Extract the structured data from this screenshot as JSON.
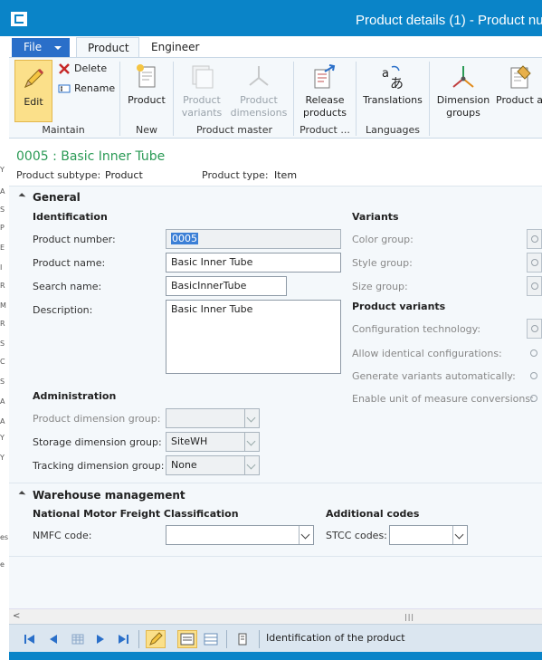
{
  "window": {
    "title": "Product details (1) - Product nu"
  },
  "left_strip": {
    "chars": [
      "Y",
      "A",
      "S",
      "P",
      "E",
      "I",
      "R",
      "M",
      "R",
      "S",
      "C",
      "S",
      "A",
      "A",
      "Y",
      "Y",
      "es",
      "e"
    ]
  },
  "tabs": {
    "file": "File",
    "product": "Product",
    "engineer": "Engineer"
  },
  "ribbon": {
    "maintain": {
      "edit": "Edit",
      "delete": "Delete",
      "rename": "Rename",
      "label": "Maintain"
    },
    "new": {
      "product": "Product",
      "label": "New"
    },
    "product_master": {
      "variants": "Product variants",
      "dimensions": "Product dimensions",
      "label": "Product master"
    },
    "product_group": {
      "release": "Release products",
      "label": "Product ..."
    },
    "languages": {
      "translations": "Translations",
      "label": "Languages"
    },
    "dimension_groups": "Dimension groups",
    "attributes": "Product attributes"
  },
  "header": {
    "product_heading": "0005 : Basic Inner Tube",
    "subtype_label": "Product subtype:",
    "subtype_value": "Product",
    "type_label": "Product type:",
    "type_value": "Item"
  },
  "general": {
    "title": "General",
    "identification": {
      "title": "Identification",
      "product_number_label": "Product number:",
      "product_number": "0005",
      "product_name_label": "Product name:",
      "product_name": "Basic Inner Tube",
      "search_name_label": "Search name:",
      "search_name": "BasicInnerTube",
      "description_label": "Description:",
      "description": "Basic Inner Tube"
    },
    "administration": {
      "title": "Administration",
      "product_dim_label": "Product dimension group:",
      "product_dim": "",
      "storage_dim_label": "Storage dimension group:",
      "storage_dim": "SiteWH",
      "tracking_dim_label": "Tracking dimension group:",
      "tracking_dim": "None"
    },
    "variants": {
      "title": "Variants",
      "color_label": "Color group:",
      "style_label": "Style group:",
      "size_label": "Size group:"
    },
    "product_variants": {
      "title": "Product variants",
      "config_label": "Configuration technology:",
      "allow_label": "Allow identical configurations:",
      "generate_label": "Generate variants automatically:",
      "enable_label": "Enable unit of measure conversions:"
    }
  },
  "warehouse": {
    "title": "Warehouse management",
    "nmfc_title": "National Motor Freight Classification",
    "nmfc_label": "NMFC code:",
    "nmfc_value": "",
    "additional_title": "Additional codes",
    "stcc_label": "STCC codes:",
    "stcc_value": ""
  },
  "status": {
    "text": "Identification of the product"
  },
  "colors": {
    "titlebar": "#0a84c8",
    "accent": "#2a9a55",
    "file_tab": "#2a6fc9",
    "edit_highlight": "#fbe08a"
  }
}
